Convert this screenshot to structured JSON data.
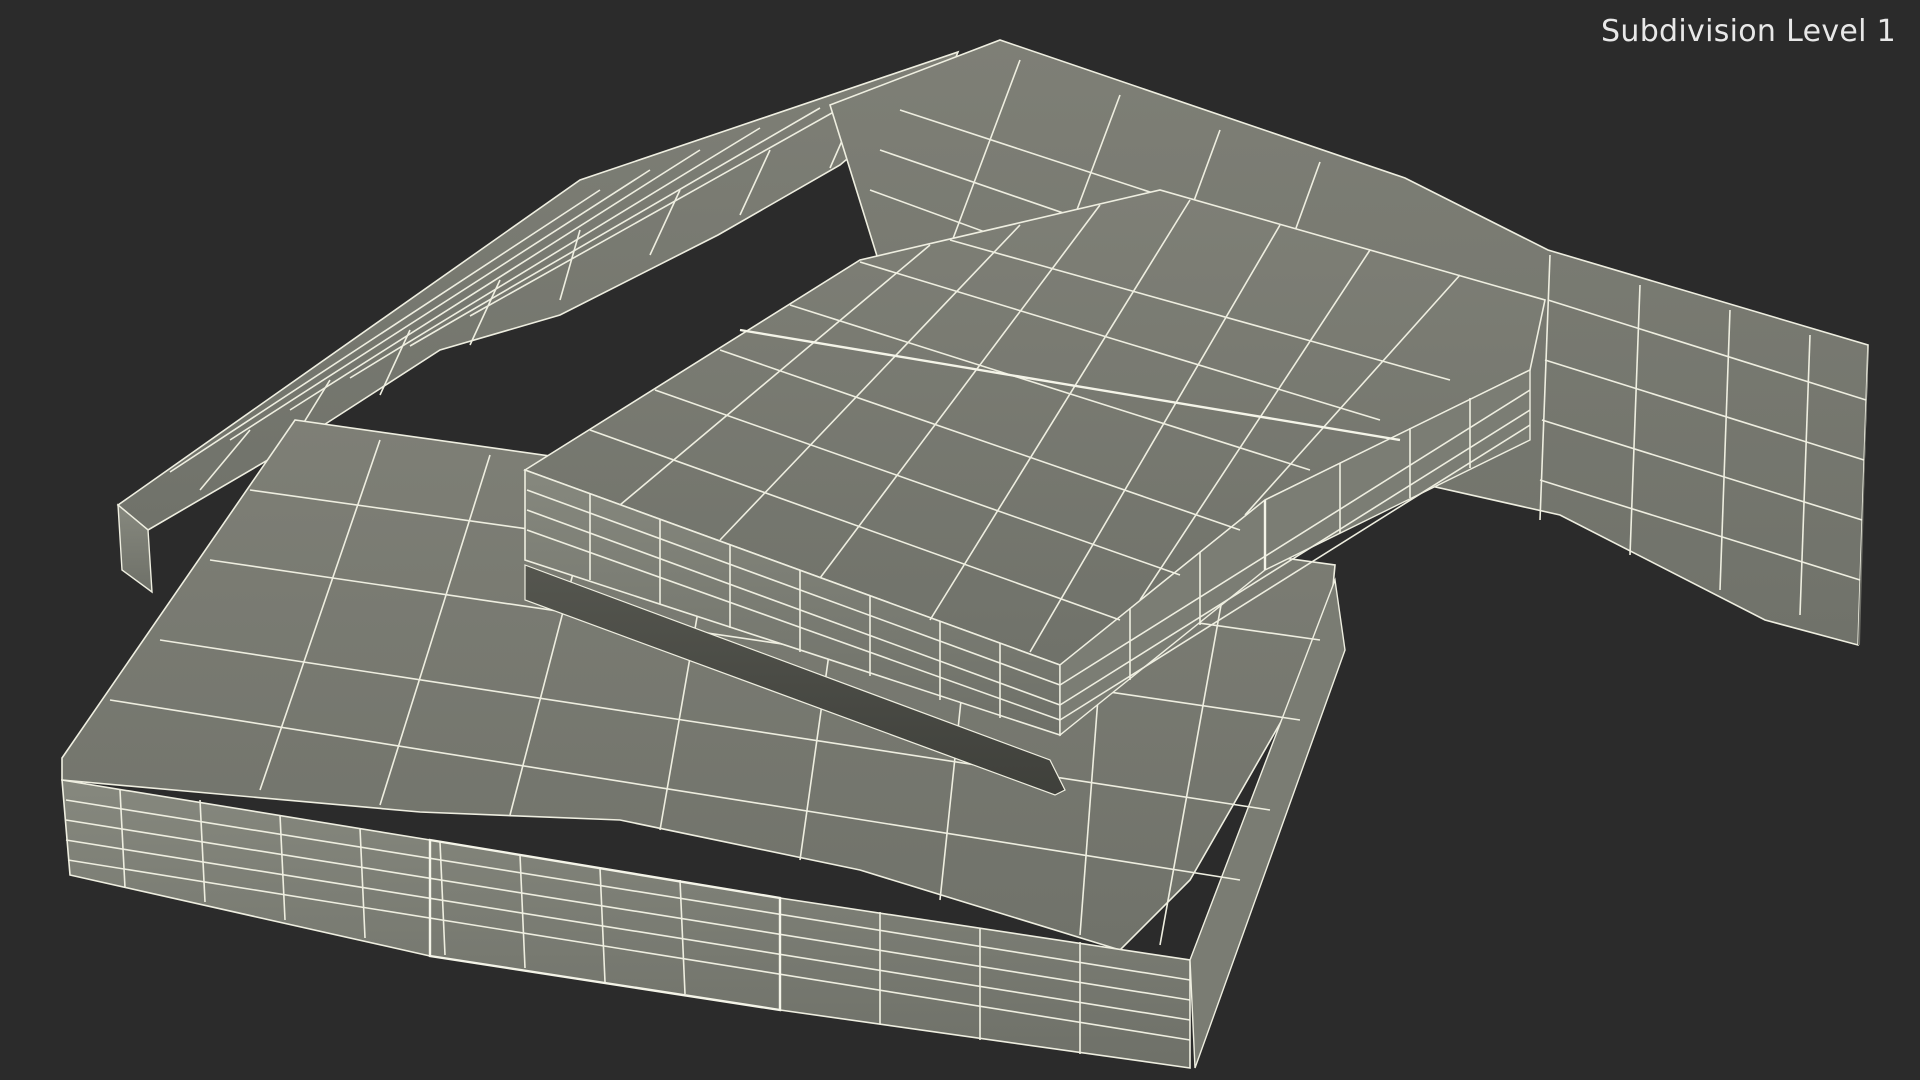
{
  "viewport": {
    "subdivision_label": "Subdivision Level 1",
    "background_color": "#2b2b2b",
    "face_color": "#777970",
    "wire_color": "#eeeee0"
  }
}
